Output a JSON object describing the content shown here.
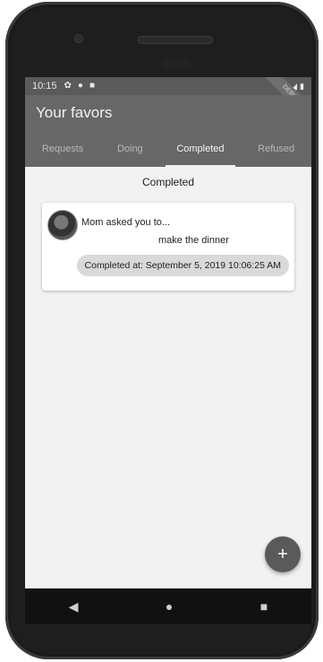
{
  "statusbar": {
    "time": "10:15",
    "left_icons": [
      "settings-icon",
      "warning-icon",
      "sd-card-icon"
    ],
    "right_icons": [
      "signal-icon",
      "battery-icon"
    ]
  },
  "debug_banner": "DEBUG",
  "appbar": {
    "title": "Your favors",
    "tabs": [
      {
        "label": "Requests"
      },
      {
        "label": "Doing"
      },
      {
        "label": "Completed"
      },
      {
        "label": "Refused"
      }
    ]
  },
  "content": {
    "section_title": "Completed",
    "card": {
      "title": "Mom asked you to...",
      "task": "make the dinner",
      "status": "Completed at: September 5, 2019 10:06:25 AM"
    }
  },
  "fab": {
    "icon": "plus-icon",
    "label": "+"
  },
  "navbar": {
    "back": "◀",
    "home": "●",
    "recents": "■"
  },
  "colors": {
    "appbar": "#676767",
    "statusbar": "#5a5a5a",
    "background": "#f2f2f2",
    "chip": "#d9d9d9"
  }
}
